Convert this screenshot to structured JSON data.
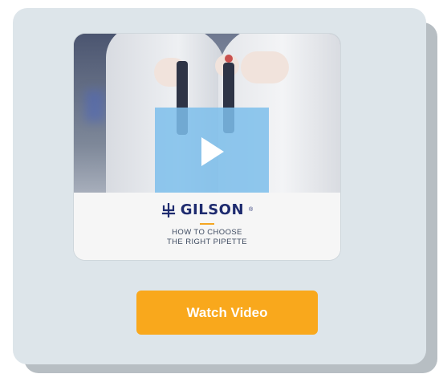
{
  "video": {
    "brand": "GILSON",
    "brand_mark": "®",
    "subtitle_line1": "HOW TO CHOOSE",
    "subtitle_line2": "THE RIGHT PIPETTE",
    "play_icon": "play-icon",
    "logo_icon": "gilson-logo-icon"
  },
  "cta": {
    "label": "Watch Video"
  },
  "colors": {
    "card_bg": "#dde5ea",
    "button": "#f9a81c",
    "brand": "#1e2b6f",
    "play_overlay": "#7dbeeb"
  }
}
